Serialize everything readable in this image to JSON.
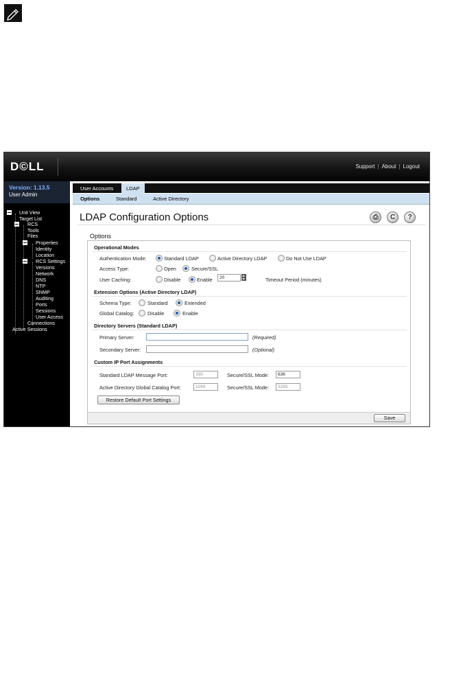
{
  "header": {
    "logo": "D©LL",
    "links": [
      "Support",
      "About",
      "Logout"
    ]
  },
  "sidebar": {
    "version": "Version: 1.13.5",
    "user": "User Admin",
    "tree": [
      "Unit View",
      "Target List",
      "RCS",
      "Tools",
      "Files",
      "Properties",
      "Identity",
      "Location",
      "RCS Settings",
      "Versions",
      "Network",
      "DNS",
      "NTP",
      "SNMP",
      "Auditing",
      "Ports",
      "Sessions",
      "User Access",
      "Connections",
      "Active Sessions"
    ]
  },
  "tabs": [
    "User Accounts",
    "LDAP"
  ],
  "subtabs": [
    "Options",
    "Standard",
    "Active Directory"
  ],
  "page": {
    "title": "LDAP Configuration Options",
    "section_label": "Options",
    "toolbar_icons": [
      "printer-icon",
      "refresh-icon",
      "help-icon"
    ]
  },
  "operational_modes": {
    "heading": "Operational Modes",
    "auth_label": "Authentication Mode:",
    "auth_options": [
      "Standard LDAP",
      "Active Directory LDAP",
      "Do Not Use LDAP"
    ],
    "auth_selected": "Standard LDAP",
    "access_label": "Access Type:",
    "access_options": [
      "Open",
      "Secure/SSL"
    ],
    "access_selected": "Secure/SSL",
    "caching_label": "User Caching:",
    "caching_options": [
      "Disable",
      "Enable"
    ],
    "caching_selected": "Enable",
    "timeout_value": "20",
    "timeout_label": "Timeout Period (minutes)"
  },
  "extension_options": {
    "heading": "Extension Options (Active Directory LDAP)",
    "schema_label": "Schema Type:",
    "schema_options": [
      "Standard",
      "Extended"
    ],
    "schema_selected": "Extended",
    "catalog_label": "Global Catalog:",
    "catalog_options": [
      "Disable",
      "Enable"
    ],
    "catalog_selected": "Enable"
  },
  "directory_servers": {
    "heading": "Directory Servers (Standard LDAP)",
    "primary_label": "Primary Server:",
    "primary_value": "",
    "primary_hint": "(Required)",
    "secondary_label": "Secondary Server:",
    "secondary_value": "",
    "secondary_hint": "(Optional)"
  },
  "ports": {
    "heading": "Custom IP Port Assignments",
    "std_label": "Standard LDAP Message Port:",
    "std_value": "389",
    "std_ssl_label": "Secure/SSL Mode:",
    "std_ssl_value": "636",
    "ad_label": "Active Directory Global Catalog Port:",
    "ad_value": "3268",
    "ad_ssl_label": "Secure/SSL Mode:",
    "ad_ssl_value": "3269",
    "restore_button": "Restore Default Port Settings"
  },
  "footer": {
    "save_button": "Save"
  }
}
